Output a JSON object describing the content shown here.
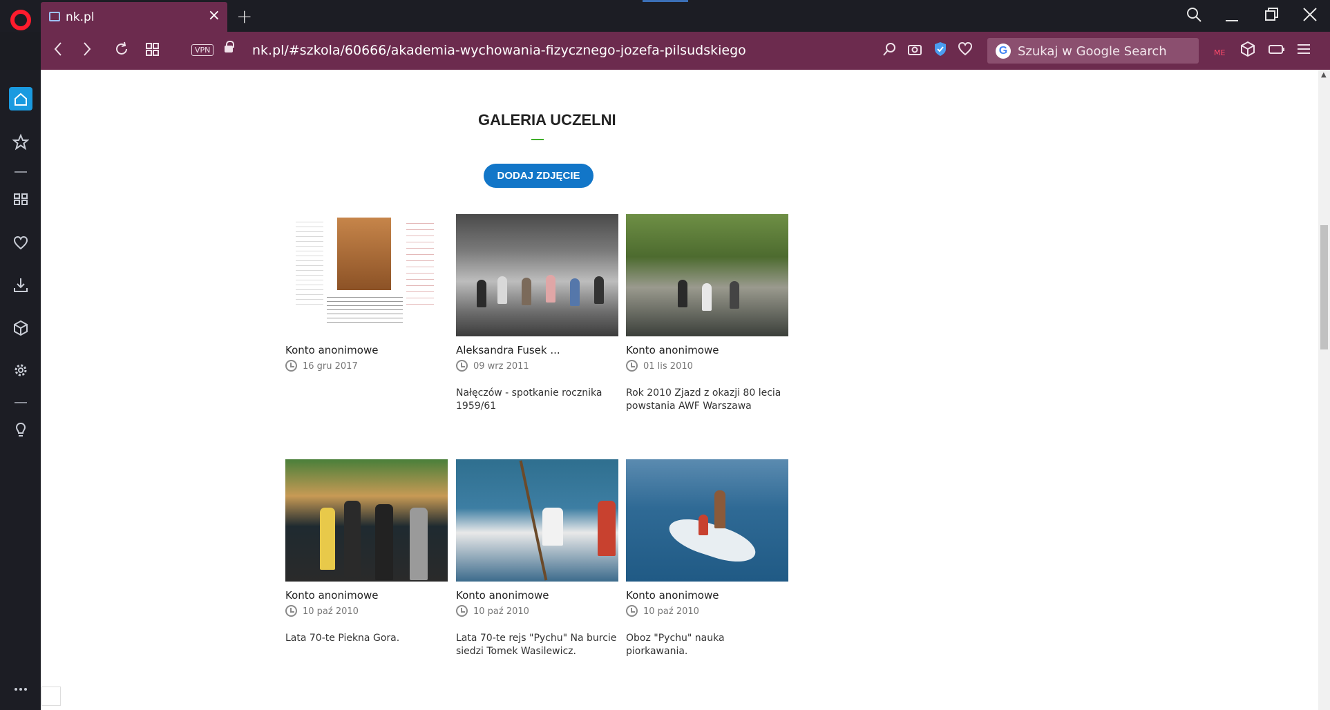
{
  "browser": {
    "tab_title": "nk.pl",
    "vpn_label": "VPN",
    "url": "nk.pl/#szkola/60666/akademia-wychowania-fizycznego-jozefa-pilsudskiego",
    "search_placeholder": "Szukaj w Google Search",
    "new_tab": "+",
    "close_tab": "×"
  },
  "gallery": {
    "title": "GALERIA UCZELNI",
    "add_button": "DODAJ ZDJĘCIE",
    "items": [
      {
        "author": "Konto anonimowe",
        "date": "16 gru 2017",
        "desc": ""
      },
      {
        "author": "Aleksandra Fusek ...",
        "date": "09 wrz 2011",
        "desc": "Nałęczów - spotkanie rocznika 1959/61"
      },
      {
        "author": "Konto anonimowe",
        "date": "01 lis 2010",
        "desc": "Rok 2010 Zjazd z okazji 80 lecia powstania AWF Warszawa"
      },
      {
        "author": "Konto anonimowe",
        "date": "10 paź 2010",
        "desc": "Lata 70-te Piekna Gora."
      },
      {
        "author": "Konto anonimowe",
        "date": "10 paź 2010",
        "desc": "Lata 70-te rejs \"Pychu\" Na burcie siedzi Tomek Wasilewicz."
      },
      {
        "author": "Konto anonimowe",
        "date": "10 paź 2010",
        "desc": "Oboz \"Pychu\" nauka piorkawania."
      }
    ]
  },
  "colors": {
    "tab_bar": "#6c2b4e",
    "accent_button": "#1276c8",
    "sidebar_active": "#1a9ae0",
    "underline": "#3fae2a"
  },
  "icons": [
    "opera-logo-icon",
    "search-icon",
    "minimize-icon",
    "restore-icon",
    "close-icon",
    "back-icon",
    "forward-icon",
    "reload-icon",
    "speed-dial-icon",
    "lock-icon",
    "snapshot-icon",
    "camera-icon",
    "shield-icon",
    "heart-icon",
    "google-icon",
    "cube-icon",
    "battery-icon",
    "settings-icon",
    "home-icon",
    "star-icon",
    "download-icon",
    "bulb-icon",
    "more-icon",
    "clock-icon"
  ]
}
